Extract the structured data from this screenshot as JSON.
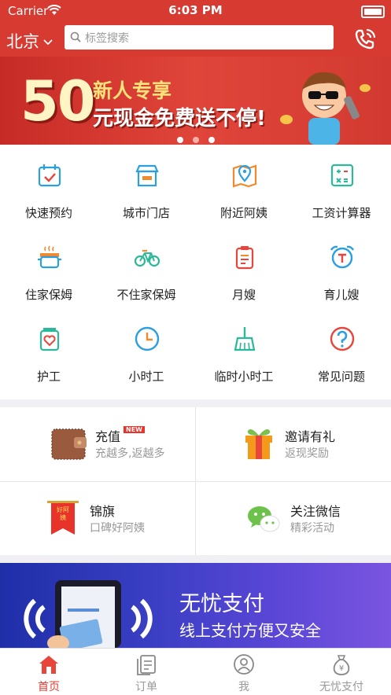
{
  "status": {
    "carrier": "Carrier",
    "time": "6:03 PM"
  },
  "nav": {
    "city": "北京",
    "search_placeholder": "标签搜索"
  },
  "banner": {
    "number": "50",
    "line1": "新人专享",
    "line2": "元现金免费送不停!"
  },
  "grid": [
    {
      "label": "快速预约",
      "icon": "calendar-check-icon",
      "color": "#2b9fe0"
    },
    {
      "label": "城市门店",
      "icon": "store-icon",
      "color": "#2b9fe0"
    },
    {
      "label": "附近阿姨",
      "icon": "map-pin-icon",
      "color": "#f08a2c"
    },
    {
      "label": "工资计算器",
      "icon": "calculator-icon",
      "color": "#2bb99a"
    },
    {
      "label": "住家保姆",
      "icon": "pot-icon",
      "color": "#f08a2c"
    },
    {
      "label": "不住家保姆",
      "icon": "bicycle-icon",
      "color": "#2bb99a"
    },
    {
      "label": "月嫂",
      "icon": "clipboard-icon",
      "color": "#e8453c"
    },
    {
      "label": "育儿嫂",
      "icon": "alarm-clock-icon",
      "color": "#2b9fe0"
    },
    {
      "label": "护工",
      "icon": "heart-jar-icon",
      "color": "#2bb99a"
    },
    {
      "label": "小时工",
      "icon": "clock-icon",
      "color": "#2b9fe0"
    },
    {
      "label": "临时小时工",
      "icon": "broom-icon",
      "color": "#2bb99a"
    },
    {
      "label": "常见问题",
      "icon": "question-icon",
      "color": "#e8453c"
    }
  ],
  "cards": [
    {
      "title": "充值",
      "badge": "NEW",
      "sub": "充越多,返越多",
      "icon": "wallet-icon"
    },
    {
      "title": "邀请有礼",
      "sub": "返现奖励",
      "icon": "gift-icon"
    },
    {
      "title": "锦旗",
      "sub": "口碑好阿姨",
      "icon": "banner-flag-icon",
      "flag_text": "好阿姨"
    },
    {
      "title": "关注微信",
      "sub": "精彩活动",
      "icon": "wechat-icon"
    }
  ],
  "pay": {
    "title": "无忧支付",
    "subtitle": "线上支付方便又安全"
  },
  "tabs": [
    {
      "label": "首页",
      "icon": "home-icon",
      "active": true
    },
    {
      "label": "订单",
      "icon": "orders-icon"
    },
    {
      "label": "我",
      "icon": "user-icon"
    },
    {
      "label": "无忧支付",
      "icon": "money-bag-icon",
      "bag_text": "¥"
    }
  ]
}
